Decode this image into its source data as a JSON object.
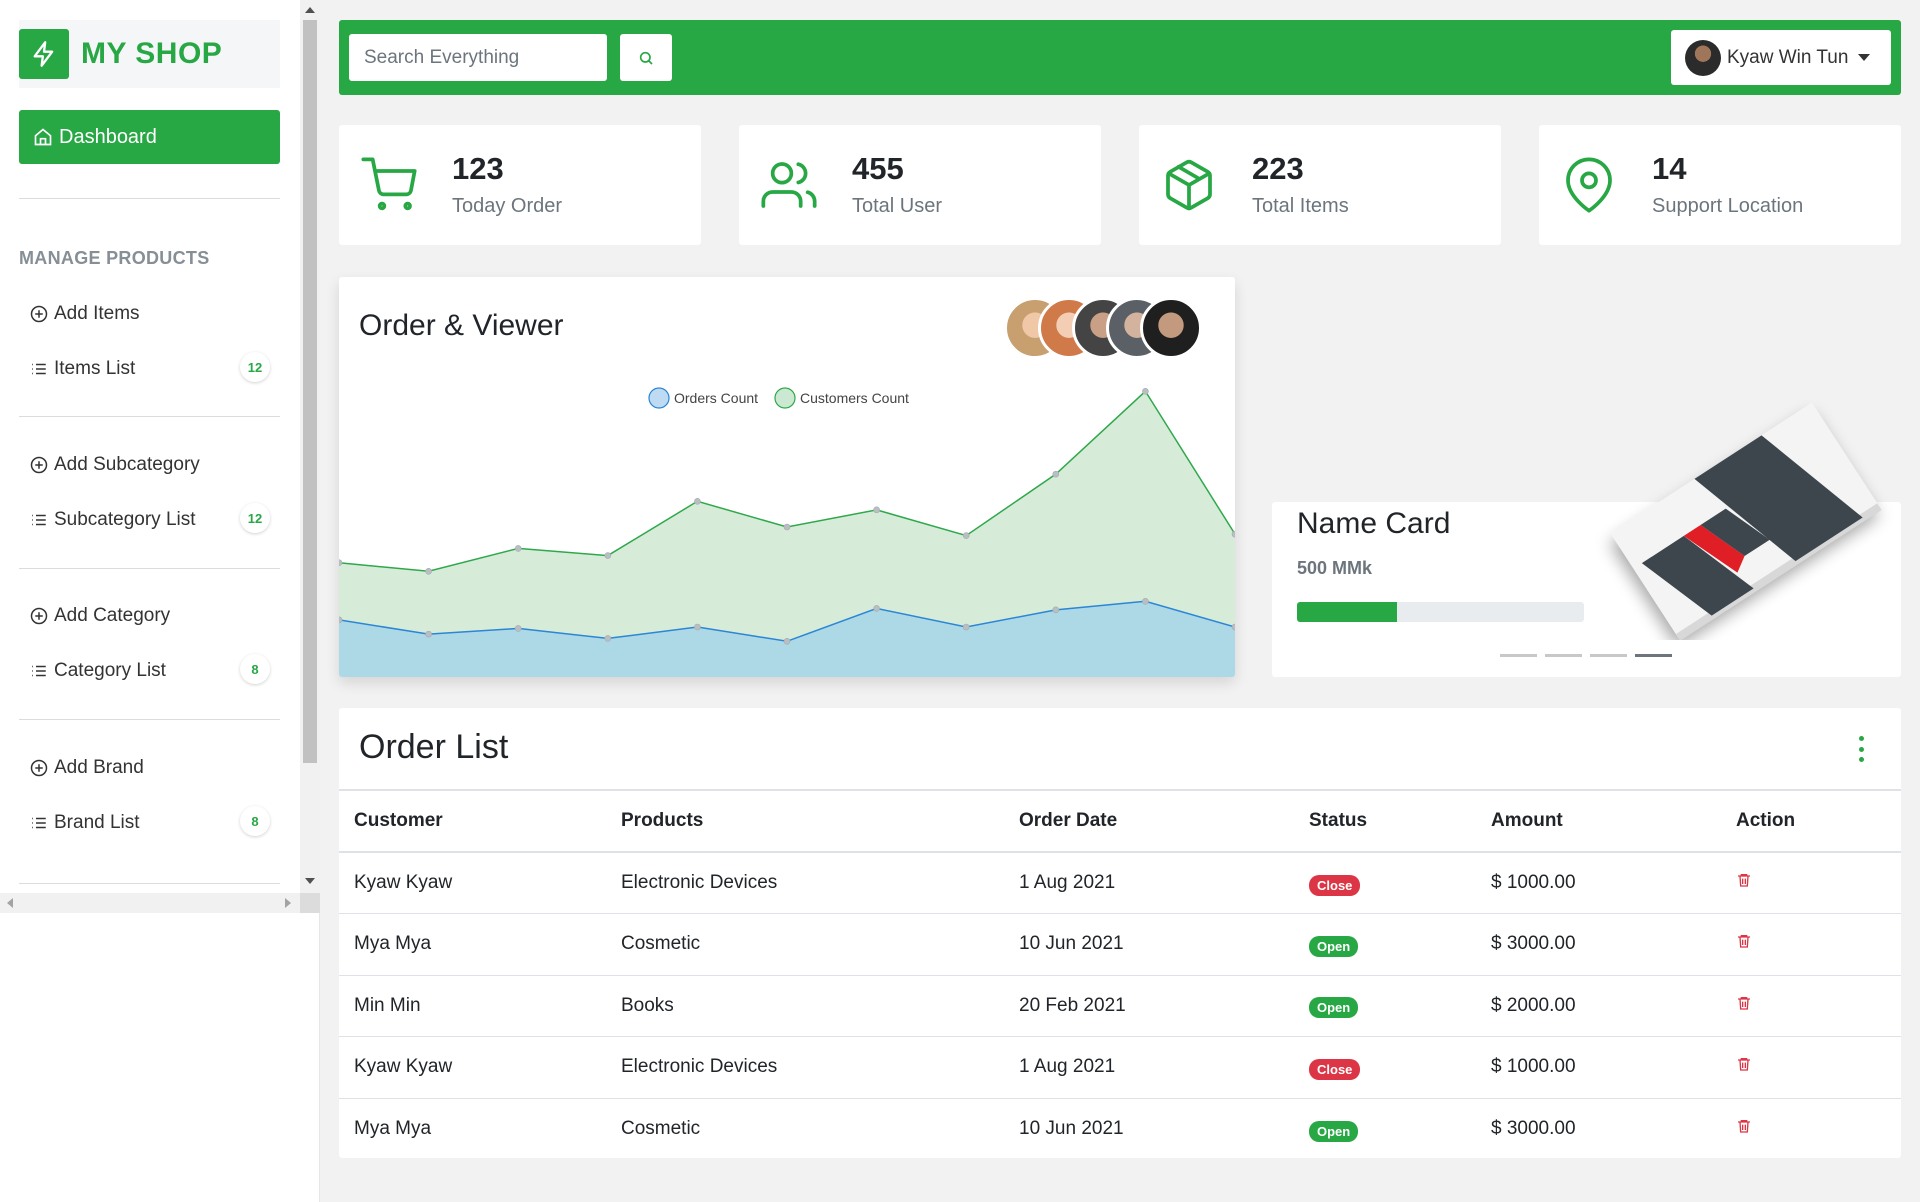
{
  "brand": {
    "name": "MY SHOP"
  },
  "sidebar": {
    "dashboard_label": "Dashboard",
    "section_title": "MANAGE PRODUCTS",
    "items": [
      {
        "label": "Add Items",
        "icon": "plus-circle-icon"
      },
      {
        "label": "Items List",
        "icon": "list-icon",
        "badge": "12"
      },
      {
        "label": "Add Subcategory",
        "icon": "plus-circle-icon"
      },
      {
        "label": "Subcategory List",
        "icon": "list-icon",
        "badge": "12"
      },
      {
        "label": "Add Category",
        "icon": "plus-circle-icon"
      },
      {
        "label": "Category List",
        "icon": "list-icon",
        "badge": "8"
      },
      {
        "label": "Add Brand",
        "icon": "plus-circle-icon"
      },
      {
        "label": "Brand List",
        "icon": "list-icon",
        "badge": "8"
      }
    ]
  },
  "topbar": {
    "search_placeholder": "Search Everything",
    "user_name": "Kyaw Win Tun"
  },
  "stats": [
    {
      "value": "123",
      "label": "Today Order",
      "icon": "cart-icon"
    },
    {
      "value": "455",
      "label": "Total User",
      "icon": "users-icon"
    },
    {
      "value": "223",
      "label": "Total Items",
      "icon": "box-icon"
    },
    {
      "value": "14",
      "label": "Support Location",
      "icon": "location-pin-icon"
    }
  ],
  "chart": {
    "title": "Order & Viewer",
    "legend": [
      "Orders Count",
      "Customers Count"
    ]
  },
  "chart_data": {
    "type": "area",
    "title": "Order & Viewer",
    "x": [
      1,
      2,
      3,
      4,
      5,
      6,
      7,
      8,
      9,
      10,
      11
    ],
    "series": [
      {
        "name": "Orders Count",
        "values": [
          40,
          30,
          34,
          27,
          35,
          25,
          48,
          35,
          47,
          53,
          35
        ]
      },
      {
        "name": "Customers Count",
        "values": [
          80,
          74,
          90,
          85,
          123,
          105,
          117,
          99,
          142,
          200,
          100
        ]
      }
    ],
    "ylim": [
      0,
      210
    ],
    "grid": false,
    "legend_position": "top-center"
  },
  "promo": {
    "title": "Name Card",
    "price": "500 MMk",
    "progress": 0.35,
    "slides": 4,
    "active_slide": 4
  },
  "orders": {
    "title": "Order List",
    "columns": [
      "Customer",
      "Products",
      "Order Date",
      "Status",
      "Amount",
      "Action"
    ],
    "rows": [
      {
        "customer": "Kyaw Kyaw",
        "product": "Electronic Devices",
        "date": "1 Aug 2021",
        "status": "Close",
        "amount": "$ 1000.00"
      },
      {
        "customer": "Mya Mya",
        "product": "Cosmetic",
        "date": "10 Jun 2021",
        "status": "Open",
        "amount": "$ 3000.00"
      },
      {
        "customer": "Min Min",
        "product": "Books",
        "date": "20 Feb 2021",
        "status": "Open",
        "amount": "$ 2000.00"
      },
      {
        "customer": "Kyaw Kyaw",
        "product": "Electronic Devices",
        "date": "1 Aug 2021",
        "status": "Close",
        "amount": "$ 1000.00"
      },
      {
        "customer": "Mya Mya",
        "product": "Cosmetic",
        "date": "10 Jun 2021",
        "status": "Open",
        "amount": "$ 3000.00"
      }
    ]
  },
  "colors": {
    "accent": "#28a745",
    "danger": "#dc3545",
    "orders_line": "#2a86d6",
    "orders_fill": "#add8e6",
    "customers_line": "#2ea84a",
    "customers_fill": "#d6ecd9"
  }
}
